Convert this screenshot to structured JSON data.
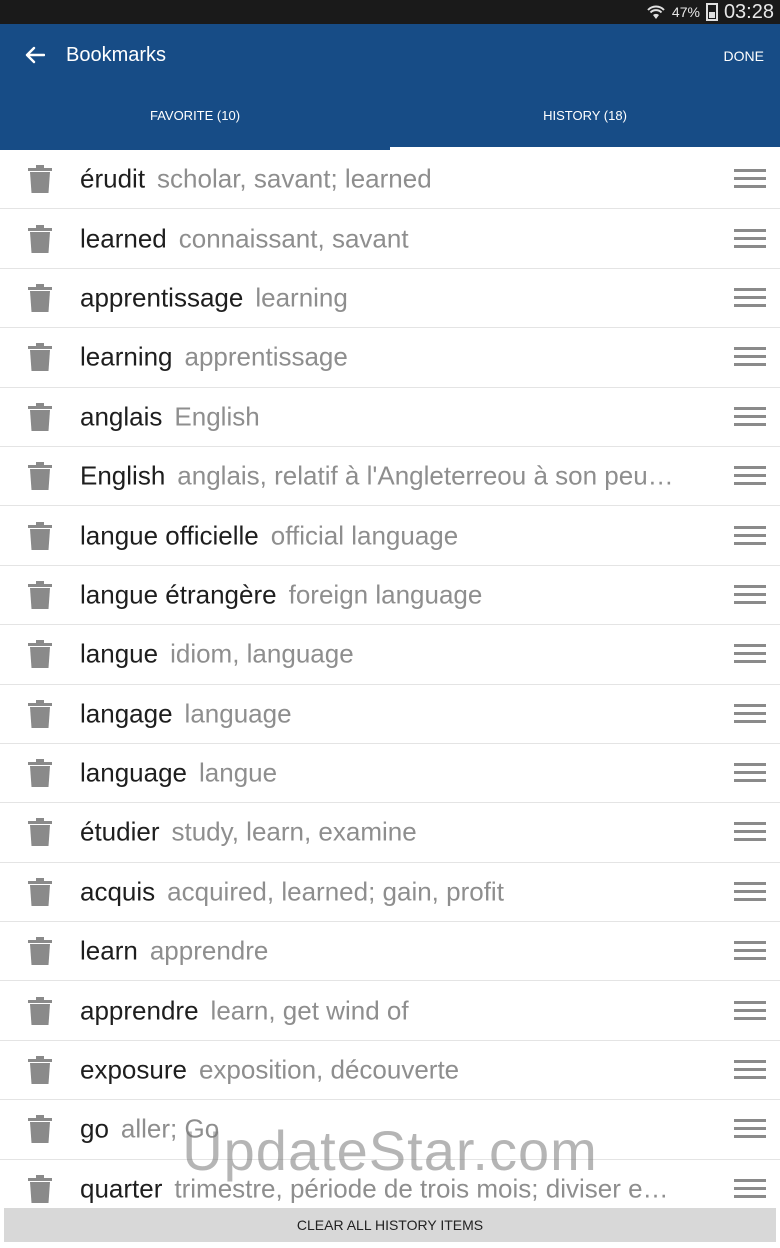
{
  "status_bar": {
    "battery": "47%",
    "time": "03:28"
  },
  "app_bar": {
    "title": "Bookmarks",
    "done_label": "DONE",
    "tabs": [
      {
        "label": "FAVORITE (10)",
        "active": false
      },
      {
        "label": "HISTORY (18)",
        "active": true
      }
    ]
  },
  "history": [
    {
      "word": "érudit",
      "translation": "scholar, savant; learned"
    },
    {
      "word": "learned",
      "translation": "connaissant, savant"
    },
    {
      "word": "apprentissage",
      "translation": "learning"
    },
    {
      "word": "learning",
      "translation": "apprentissage"
    },
    {
      "word": "anglais",
      "translation": "English"
    },
    {
      "word": "English",
      "translation": "anglais, relatif à l'Angleterreou à son peu…"
    },
    {
      "word": "langue officielle",
      "translation": "official language"
    },
    {
      "word": "langue étrangère",
      "translation": "foreign language"
    },
    {
      "word": "langue",
      "translation": "idiom, language"
    },
    {
      "word": "langage",
      "translation": "language"
    },
    {
      "word": "language",
      "translation": "langue"
    },
    {
      "word": "étudier",
      "translation": "study, learn, examine"
    },
    {
      "word": "acquis",
      "translation": "acquired, learned; gain, profit"
    },
    {
      "word": "learn",
      "translation": "apprendre"
    },
    {
      "word": "apprendre",
      "translation": "learn, get wind of"
    },
    {
      "word": "exposure",
      "translation": "exposition, découverte"
    },
    {
      "word": "go",
      "translation": "aller; Go"
    },
    {
      "word": "quarter",
      "translation": "trimestre, période de trois mois; diviser e…"
    }
  ],
  "watermark": "UpdateStar.com",
  "clear_button_label": "CLEAR ALL HISTORY ITEMS",
  "icons": {
    "back": "arrow-left-icon",
    "delete": "trash-icon",
    "reorder": "drag-handle-icon",
    "wifi": "wifi-icon",
    "battery": "battery-icon"
  },
  "colors": {
    "app_bar": "#174c86",
    "status_bar": "#1a1a1a",
    "word": "#1e1e1e",
    "translation": "#8e8e8e",
    "icon_gray": "#8a8a8a"
  }
}
